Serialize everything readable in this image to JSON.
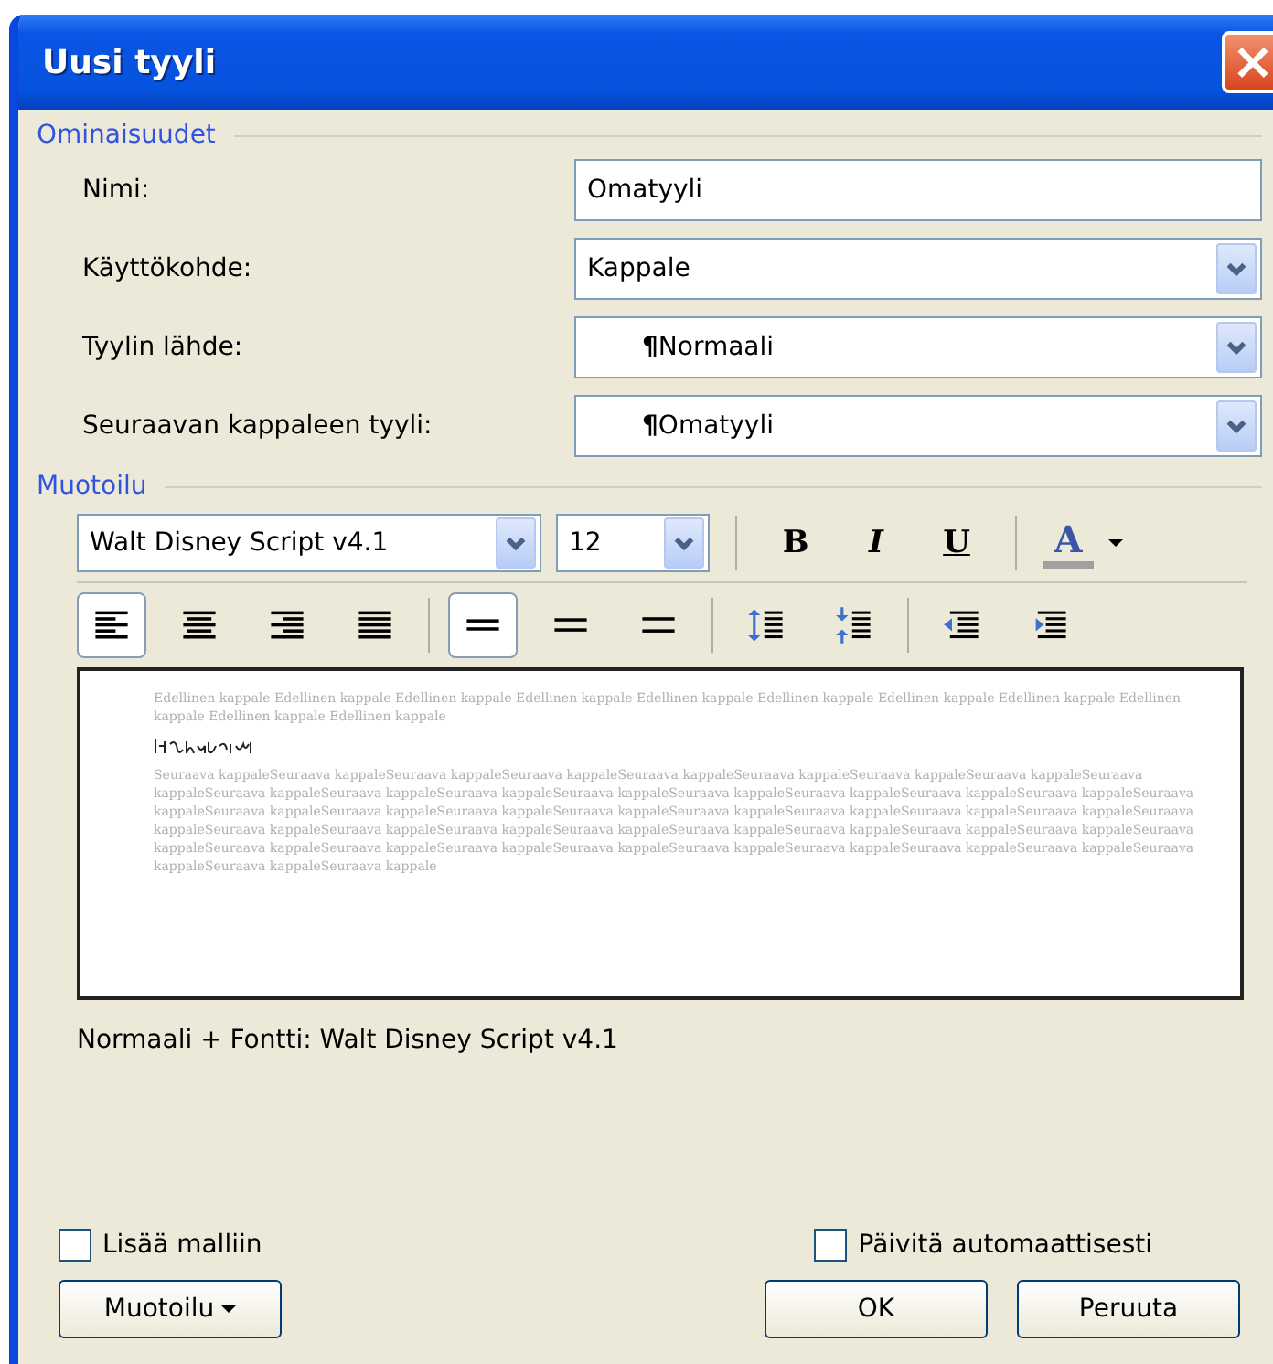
{
  "window": {
    "title": "Uusi tyyli",
    "close": "×"
  },
  "properties": {
    "heading": "Ominaisuudet",
    "fields": [
      {
        "label": "Nimi:",
        "kind": "text",
        "value": "Omatyyli"
      },
      {
        "label": "Käyttökohde:",
        "kind": "dropdown",
        "value": "Kappale"
      },
      {
        "label": "Tyylin lähde:",
        "kind": "dropdown",
        "mark": "¶",
        "value": "Normaali"
      },
      {
        "label": "Seuraavan kappaleen tyyli:",
        "kind": "dropdown",
        "mark": "¶",
        "value": "Omatyyli"
      }
    ]
  },
  "formatting": {
    "heading": "Muotoilu",
    "font": "Walt Disney Script v4.1",
    "size": "12",
    "text_buttons": [
      {
        "kind": "bold",
        "label": "B"
      },
      {
        "kind": "italic",
        "label": "I"
      },
      {
        "kind": "underline",
        "label": "U"
      },
      {
        "kind": "color",
        "label": "A"
      }
    ],
    "paragraph_buttons": [
      {
        "kind": "align-left",
        "selected": true
      },
      {
        "kind": "align-center",
        "selected": false
      },
      {
        "kind": "align-right",
        "selected": false
      },
      {
        "kind": "justify",
        "selected": false
      },
      {
        "kind": "single",
        "selected": true
      },
      {
        "kind": "one-half",
        "selected": false
      },
      {
        "kind": "double",
        "selected": false
      },
      {
        "kind": "space-more",
        "selected": false
      },
      {
        "kind": "space-less",
        "selected": false
      },
      {
        "kind": "outdent",
        "selected": false
      },
      {
        "kind": "indent",
        "selected": false
      }
    ],
    "preview": {
      "previous": "Edellinen kappale Edellinen kappale Edellinen kappale Edellinen kappale Edellinen kappale Edellinen kappale Edellinen kappale Edellinen kappale Edellinen kappale Edellinen kappale Edellinen kappale",
      "next": "Seuraava kappaleSeuraava kappaleSeuraava kappaleSeuraava kappaleSeuraava kappaleSeuraava kappaleSeuraava kappaleSeuraava kappaleSeuraava kappaleSeuraava kappaleSeuraava kappaleSeuraava kappaleSeuraava kappaleSeuraava kappaleSeuraava kappaleSeuraava kappaleSeuraava kappaleSeuraava kappaleSeuraava kappaleSeuraava kappaleSeuraava kappaleSeuraava kappaleSeuraava kappaleSeuraava kappaleSeuraava kappaleSeuraava kappaleSeuraava kappaleSeuraava kappaleSeuraava kappaleSeuraava kappaleSeuraava kappaleSeuraava kappaleSeuraava kappaleSeuraava kappaleSeuraava kappaleSeuraava kappaleSeuraava kappaleSeuraava kappaleSeuraava kappaleSeuraava kappaleSeuraava kappaleSeuraava kappaleSeuraava kappaleSeuraava kappaleSeuraava kappaleSeuraava kappaleSeuraava kappale"
    },
    "summary": "Normaali + Fontti: Walt Disney Script v4.1"
  },
  "options": [
    {
      "label": "Lisää malliin",
      "checked": false
    },
    {
      "label": "Päivitä automaattisesti",
      "checked": false
    }
  ],
  "buttons": {
    "menu": "Muotoilu",
    "ok": "OK",
    "cancel": "Peruuta"
  }
}
